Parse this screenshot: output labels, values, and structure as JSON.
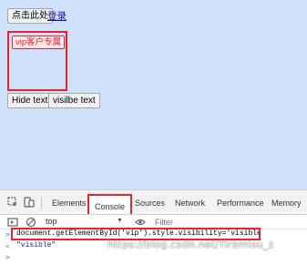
{
  "page": {
    "click_button": "点击此处",
    "login_link": "登录",
    "vip_button": "vip客户专属",
    "hide_button": "Hide text",
    "visible_button": "visilbe text"
  },
  "devtools": {
    "tabs": [
      "Elements",
      "Console",
      "Sources",
      "Network",
      "Performance",
      "Memory"
    ],
    "active_tab": "Console",
    "context": "top",
    "filter_placeholder": "Filter",
    "command": "document.getElementById('vip').style.visibility='visible'",
    "result": "\"visible\""
  },
  "watermark": "https://blog.csdn.net/Tiramisu_z",
  "colors": {
    "page_bg": "#cfe1fb",
    "highlight": "#e8232c"
  }
}
